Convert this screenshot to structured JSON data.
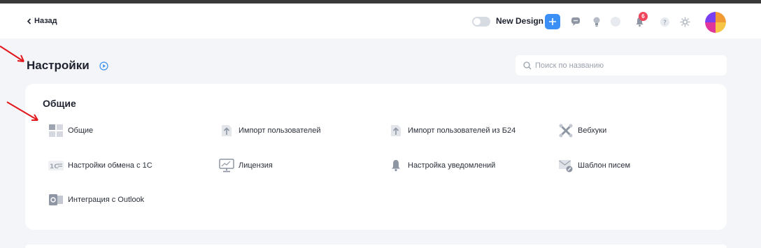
{
  "topbar": {
    "back_label": "Назад",
    "new_design_label": "New Design",
    "notification_count": "6",
    "icons": [
      "chat-icon",
      "bulb-icon",
      "status-circle-icon",
      "bell-icon",
      "help-icon",
      "settings-icon"
    ]
  },
  "page": {
    "title": "Настройки"
  },
  "search": {
    "placeholder": "Поиск по названию"
  },
  "section": {
    "title": "Общие",
    "items": [
      {
        "label": "Общие",
        "icon": "grid-icon"
      },
      {
        "label": "Импорт пользователей",
        "icon": "upload-arrow-icon"
      },
      {
        "label": "Импорт пользователей из Б24",
        "icon": "upload-arrow-icon"
      },
      {
        "label": "Вебхуки",
        "icon": "webhook-icon"
      },
      {
        "label": "Настройки обмена с 1С",
        "icon": "1c-icon"
      },
      {
        "label": "Лицензия",
        "icon": "monitor-icon"
      },
      {
        "label": "Настройка уведомлений",
        "icon": "bell-icon"
      },
      {
        "label": "Шаблон писем",
        "icon": "mail-template-icon"
      },
      {
        "label": "Интеграция с Outlook",
        "icon": "outlook-icon"
      }
    ]
  },
  "colors": {
    "accent": "#3c8ff5",
    "badge": "#f0455a",
    "background": "#f3f5f8",
    "annotation_arrow": "#e3161b"
  }
}
